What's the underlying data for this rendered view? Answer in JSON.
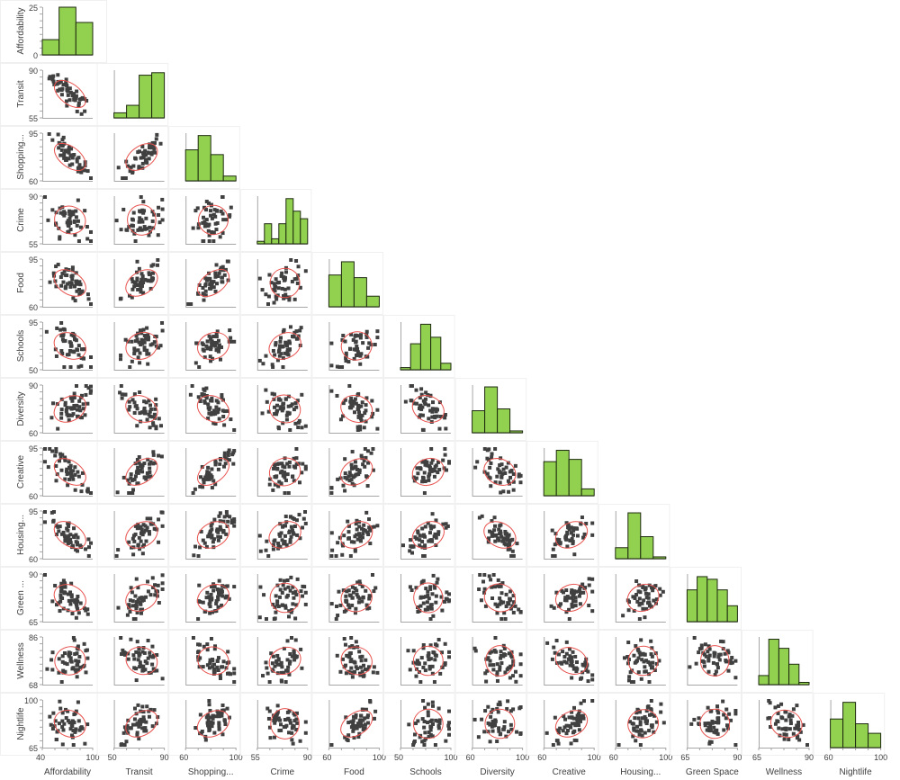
{
  "chart_data": {
    "type": "scatter-matrix",
    "title": "",
    "variables": [
      {
        "name": "Affordability",
        "label": "Affordability",
        "range": [
          40,
          100
        ],
        "ticks": [
          "40",
          "100"
        ]
      },
      {
        "name": "Transit",
        "label": "Transit",
        "range": [
          55,
          90
        ],
        "ticks": [
          "50",
          "90"
        ]
      },
      {
        "name": "Shopping",
        "label": "Shopping...",
        "range": [
          60,
          95
        ],
        "ticks": [
          "60",
          "100"
        ]
      },
      {
        "name": "Crime",
        "label": "Crime",
        "range": [
          55,
          90
        ],
        "ticks": [
          "55",
          "90"
        ]
      },
      {
        "name": "Food",
        "label": "Food",
        "range": [
          60,
          95
        ],
        "ticks": [
          "60",
          "100"
        ]
      },
      {
        "name": "Schools",
        "label": "Schools",
        "range": [
          50,
          95
        ],
        "ticks": [
          "50",
          "100"
        ]
      },
      {
        "name": "Diversity",
        "label": "Diversity",
        "range": [
          60,
          90
        ],
        "ticks": [
          "60",
          "100"
        ]
      },
      {
        "name": "Creative",
        "label": "Creative",
        "range": [
          60,
          95
        ],
        "ticks": [
          "60",
          "100"
        ]
      },
      {
        "name": "Housing",
        "label": "Housing...",
        "range": [
          60,
          95
        ],
        "ticks": [
          "60",
          "100"
        ]
      },
      {
        "name": "Green Space",
        "label": "Green Space",
        "y_label": "Green ...",
        "range": [
          65,
          90
        ],
        "ticks": [
          "65",
          "90"
        ]
      },
      {
        "name": "Wellness",
        "label": "Wellness",
        "range": [
          68,
          86
        ],
        "ticks": [
          "65",
          "90"
        ]
      },
      {
        "name": "Nightlife",
        "label": "Nightlife",
        "range": [
          65,
          100
        ],
        "ticks": [
          "60",
          "100"
        ]
      }
    ],
    "row_axis_ticks": [
      [
        "25",
        "0"
      ],
      [
        "90",
        "55"
      ],
      [
        "95",
        "60"
      ],
      [
        "90",
        "55"
      ],
      [
        "95",
        "60"
      ],
      [
        "95",
        "50"
      ],
      [
        "90",
        "60"
      ],
      [
        "95",
        "60"
      ],
      [
        "95",
        "60"
      ],
      [
        "90",
        "65"
      ],
      [
        "86",
        "68"
      ],
      [
        "100",
        "65"
      ]
    ],
    "histograms": [
      {
        "variable": "Affordability",
        "counts": [
          8,
          25,
          17
        ],
        "ymax": 25
      },
      {
        "variable": "Transit",
        "counts": [
          2,
          5,
          17,
          18
        ],
        "ymax": 19
      },
      {
        "variable": "Shopping",
        "counts": [
          13,
          19,
          11,
          2
        ],
        "ymax": 20
      },
      {
        "variable": "Crime",
        "counts": [
          1,
          8,
          2,
          8,
          18,
          13,
          10
        ],
        "ymax": 19
      },
      {
        "variable": "Food",
        "counts": [
          12,
          17,
          11,
          4
        ],
        "ymax": 18
      },
      {
        "variable": "Schools",
        "counts": [
          1,
          12,
          21,
          15,
          3
        ],
        "ymax": 22
      },
      {
        "variable": "Diversity",
        "counts": [
          12,
          25,
          13,
          1
        ],
        "ymax": 26
      },
      {
        "variable": "Creative",
        "counts": [
          15,
          20,
          16,
          3
        ],
        "ymax": 21
      },
      {
        "variable": "Housing",
        "counts": [
          6,
          25,
          12,
          1
        ],
        "ymax": 26
      },
      {
        "variable": "Green Space",
        "counts": [
          12,
          17,
          16,
          12,
          6
        ],
        "ymax": 18
      },
      {
        "variable": "Wellness",
        "counts": [
          4,
          20,
          16,
          9,
          1
        ],
        "ymax": 21
      },
      {
        "variable": "Nightlife",
        "counts": [
          12,
          19,
          10,
          6
        ],
        "ymax": 20
      }
    ],
    "correlations": [
      [
        1.0
      ],
      [
        -0.85,
        1.0
      ],
      [
        -0.85,
        0.75,
        1.0
      ],
      [
        -0.35,
        0.1,
        0.2,
        1.0
      ],
      [
        -0.7,
        0.7,
        0.8,
        0.2,
        1.0
      ],
      [
        -0.55,
        0.45,
        0.45,
        0.55,
        0.3,
        1.0
      ],
      [
        0.6,
        -0.55,
        -0.55,
        -0.35,
        -0.45,
        -0.5,
        1.0
      ],
      [
        -0.75,
        0.75,
        0.8,
        0.35,
        0.6,
        0.45,
        -0.5,
        1.0
      ],
      [
        -0.75,
        0.6,
        0.6,
        0.55,
        0.55,
        0.55,
        -0.6,
        0.6,
        1.0
      ],
      [
        -0.55,
        0.55,
        0.5,
        0.2,
        0.35,
        0.15,
        -0.35,
        0.45,
        0.45,
        1.0
      ],
      [
        0.3,
        -0.4,
        -0.35,
        0.45,
        -0.35,
        0.2,
        -0.1,
        -0.5,
        0.2,
        -0.1,
        1.0
      ],
      [
        -0.45,
        0.65,
        0.6,
        -0.1,
        0.75,
        0.2,
        -0.2,
        0.6,
        0.3,
        0.2,
        -0.4,
        1.0
      ]
    ],
    "n_points": 50,
    "marker": "square",
    "ellipse": "confidence ellipse (red)",
    "colors": {
      "histogram_fill": "#92d050",
      "histogram_edge": "#1e2a10",
      "point": "#404040",
      "ellipse": "#e8534f",
      "axis": "#a6a6a6",
      "cell_border": "#f0f0f0"
    },
    "grid": false,
    "legend": "none"
  }
}
